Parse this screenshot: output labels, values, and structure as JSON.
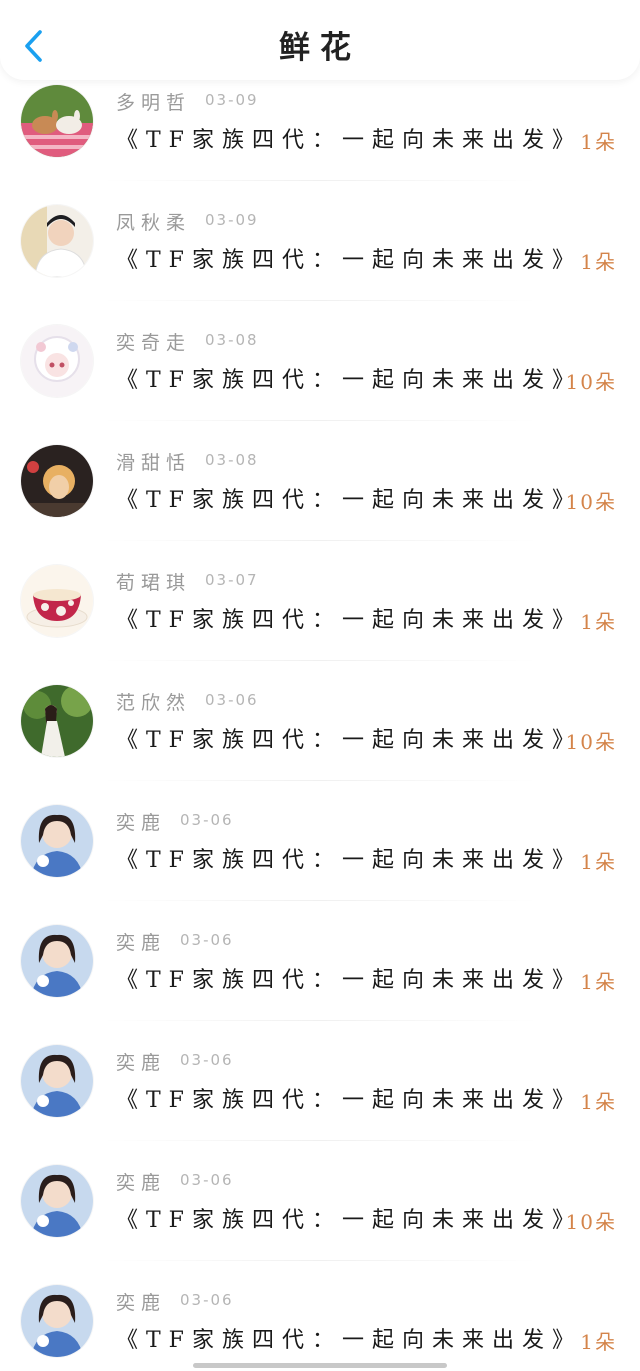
{
  "header": {
    "title": "鲜花",
    "back_icon": "chevron-left-icon"
  },
  "accent_color": "#1aa0f0",
  "amount_color": "#d4844a",
  "rows": [
    {
      "name": "多明哲",
      "date": "03-09",
      "title": "《TF家族四代：一起向未来出发》",
      "amount": "1朵",
      "avatar_icon": "rabbits-avatar"
    },
    {
      "name": "凤秋柔",
      "date": "03-09",
      "title": "《TF家族四代：一起向未来出发》",
      "amount": "1朵",
      "avatar_icon": "boy-portrait-avatar"
    },
    {
      "name": "奕奇走",
      "date": "03-08",
      "title": "《TF家族四代：一起向未来出发》",
      "amount": "10朵",
      "avatar_icon": "anime-girl-avatar"
    },
    {
      "name": "滑甜恬",
      "date": "03-08",
      "title": "《TF家族四代：一起向未来出发》",
      "amount": "10朵",
      "avatar_icon": "girl-portrait-avatar"
    },
    {
      "name": "荀珺琪",
      "date": "03-07",
      "title": "《TF家族四代：一起向未来出发》",
      "amount": "1朵",
      "avatar_icon": "teacup-avatar"
    },
    {
      "name": "范欣然",
      "date": "03-06",
      "title": "《TF家族四代：一起向未来出发》",
      "amount": "10朵",
      "avatar_icon": "forest-girl-avatar"
    },
    {
      "name": "奕鹿",
      "date": "03-06",
      "title": "《TF家族四代：一起向未来出发》",
      "amount": "1朵",
      "avatar_icon": "woman-portrait-avatar"
    },
    {
      "name": "奕鹿",
      "date": "03-06",
      "title": "《TF家族四代：一起向未来出发》",
      "amount": "1朵",
      "avatar_icon": "woman-portrait-avatar"
    },
    {
      "name": "奕鹿",
      "date": "03-06",
      "title": "《TF家族四代：一起向未来出发》",
      "amount": "1朵",
      "avatar_icon": "woman-portrait-avatar"
    },
    {
      "name": "奕鹿",
      "date": "03-06",
      "title": "《TF家族四代：一起向未来出发》",
      "amount": "10朵",
      "avatar_icon": "woman-portrait-avatar"
    },
    {
      "name": "奕鹿",
      "date": "03-06",
      "title": "《TF家族四代：一起向未来出发》",
      "amount": "1朵",
      "avatar_icon": "woman-portrait-avatar"
    }
  ]
}
